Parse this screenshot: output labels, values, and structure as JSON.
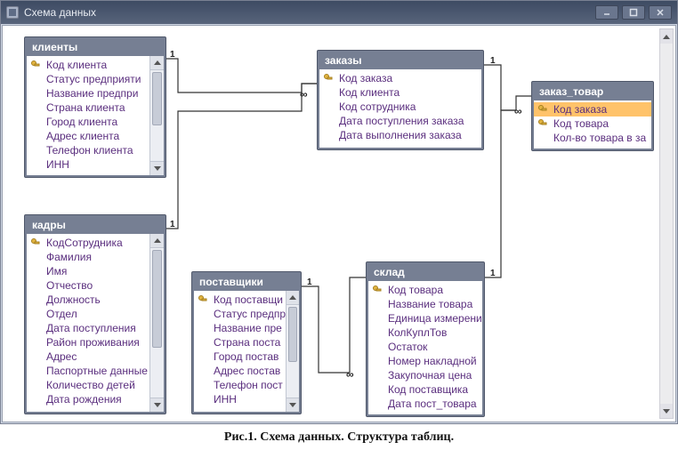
{
  "window": {
    "title": "Схема данных",
    "buttons": {
      "minimize": "minimize",
      "maximize": "maximize",
      "close": "close"
    }
  },
  "caption": "Рис.1. Схема данных. Структура таблиц.",
  "tables": {
    "klienty": {
      "title": "клиенты",
      "fields": [
        {
          "name": "Код клиента",
          "pk": true
        },
        {
          "name": "Статус предприяти"
        },
        {
          "name": "Название предпри"
        },
        {
          "name": "Страна клиента"
        },
        {
          "name": "Город клиента"
        },
        {
          "name": "Адрес клиента"
        },
        {
          "name": "Телефон клиента"
        },
        {
          "name": "ИНН"
        }
      ]
    },
    "zakazy": {
      "title": "заказы",
      "fields": [
        {
          "name": "Код заказа",
          "pk": true
        },
        {
          "name": "Код клиента"
        },
        {
          "name": "Код сотрудника"
        },
        {
          "name": "Дата поступления заказа"
        },
        {
          "name": "Дата выполнения заказа"
        }
      ]
    },
    "zakaz_tovar": {
      "title": "заказ_товар",
      "fields": [
        {
          "name": "Код заказа",
          "pk": true,
          "selected": true
        },
        {
          "name": "Код товара",
          "pk": true
        },
        {
          "name": "Кол-во товара в за"
        }
      ]
    },
    "kadry": {
      "title": "кадры",
      "fields": [
        {
          "name": "КодСотрудника",
          "pk": true
        },
        {
          "name": "Фамилия"
        },
        {
          "name": "Имя"
        },
        {
          "name": "Отчество"
        },
        {
          "name": "Должность"
        },
        {
          "name": "Отдел"
        },
        {
          "name": "Дата поступления"
        },
        {
          "name": "Район проживания"
        },
        {
          "name": "Адрес"
        },
        {
          "name": "Паспортные данные"
        },
        {
          "name": "Количество детей"
        },
        {
          "name": "Дата рождения"
        }
      ]
    },
    "postavshiki": {
      "title": "поставщики",
      "fields": [
        {
          "name": "Код поставщи",
          "pk": true
        },
        {
          "name": "Статус предпр"
        },
        {
          "name": "Название пре"
        },
        {
          "name": "Страна поста"
        },
        {
          "name": "Город постав"
        },
        {
          "name": "Адрес постав"
        },
        {
          "name": "Телефон пост"
        },
        {
          "name": "ИНН"
        }
      ]
    },
    "sklad": {
      "title": "склад",
      "fields": [
        {
          "name": "Код товара",
          "pk": true
        },
        {
          "name": "Название товара"
        },
        {
          "name": "Единица измерения"
        },
        {
          "name": "КолКуплТов"
        },
        {
          "name": "Остаток"
        },
        {
          "name": "Номер накладной"
        },
        {
          "name": "Закупочная цена"
        },
        {
          "name": "Код поставщика"
        },
        {
          "name": "Дата пост_товара"
        }
      ]
    }
  },
  "relationships": [
    {
      "from": "klienty",
      "to": "zakazy",
      "card_from": "1",
      "card_to": "∞"
    },
    {
      "from": "kadry",
      "to": "zakazy",
      "card_from": "1",
      "card_to": "∞"
    },
    {
      "from": "zakazy",
      "to": "zakaz_tovar",
      "card_from": "1",
      "card_to": "∞"
    },
    {
      "from": "sklad",
      "to": "zakaz_tovar",
      "card_from": "1",
      "card_to": "∞"
    },
    {
      "from": "postavshiki",
      "to": "sklad",
      "card_from": "1",
      "card_to": "∞"
    }
  ]
}
